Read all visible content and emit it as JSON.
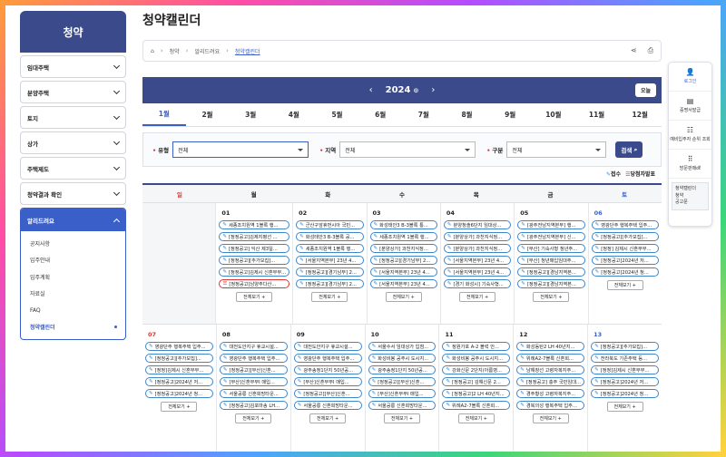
{
  "sidebar": {
    "title": "청약",
    "menus": [
      "임대주택",
      "분양주택",
      "토지",
      "상가",
      "주택제도",
      "청약결과 확인"
    ],
    "open_menu": "알리드려요",
    "sub_items": [
      "공지사항",
      "입주안내",
      "입주계획",
      "자료실",
      "FAQ",
      "청약캘린더"
    ]
  },
  "page_title": "청약캘린더",
  "breadcrumb": {
    "items": [
      "청약",
      "알리드려요",
      "청약캘린더"
    ]
  },
  "calendar": {
    "year": "2024",
    "today_label": "오늘",
    "months": [
      "1월",
      "2월",
      "3월",
      "4월",
      "5월",
      "6월",
      "7월",
      "8월",
      "9월",
      "10월",
      "11월",
      "12월"
    ],
    "weekdays": [
      "일",
      "월",
      "화",
      "수",
      "목",
      "금",
      "토"
    ],
    "more_label": "전체보기 +"
  },
  "filter": {
    "type_label": "유형",
    "type_value": "전체",
    "region_label": "지역",
    "region_value": "전체",
    "cat_label": "구분",
    "cat_value": "전체",
    "search_label": "검색"
  },
  "legend": {
    "receipt": "접수",
    "announce": "당첨자발표"
  },
  "week1": {
    "d1": "01",
    "d2": "02",
    "d3": "03",
    "d4": "04",
    "d5": "05",
    "d6": "06",
    "mon": [
      "세종조치원역 1블록 행...",
      "[정정공고]김제지평선 ...",
      "[정정공고] 익산 제3일...",
      "[정정공고][추가모집]...",
      "[정정공고]김제시 신혼부부...",
      "[정정공고]남양주다산..."
    ],
    "tue": [
      "군산구암휴먼시아 국민...",
      "화성태안3 B-3블록 공...",
      "세종조치원역 1블록 행...",
      "[서울지역본부] 23년 4...",
      "[정정공고][경기남부] 2...",
      "[정정공고][경기남부] 2..."
    ],
    "wed": [
      "화성태안3 B-3블록 통...",
      "세종조치원역 1블록 행...",
      "[분양상가] 과천지식정...",
      "[정정공고][경기남부] 2...",
      "[서울지역본부] 23년 4...",
      "[서울지역본부] 23년 4..."
    ],
    "thu": [
      "분양청솔6단지 임대상...",
      "[분양상가] 과천지식정...",
      "[분양상가] 과천지식정...",
      "[서울지역본부] 23년 4...",
      "[서울지역본부] 23년 4...",
      "[경기 화성시] 기숙사형..."
    ],
    "fri": [
      "[광주전남지역본부] 행...",
      "[광주전남지역본부] 신...",
      "[부산] 기숙사형 청년주...",
      "[부산] 청년매입임대주...",
      "[정정공고][경남지역본...",
      "[정정공고][경남지역본..."
    ],
    "sat": [
      "영광단주 행복주택 입주...",
      "[정정공고][추가모집]...",
      "[정정] 김제시 신혼부부...",
      "[정정공고]2024년 저...",
      "[정정공고]2024년 청..."
    ]
  },
  "week2": {
    "d0": "07",
    "d1": "08",
    "d2": "09",
    "d3": "10",
    "d4": "11",
    "d5": "12",
    "d6": "13",
    "sun": [
      "영광단주 행복주택 입주...",
      "[정정공고][추가모집]...",
      "[정정]김제시 신혼부부...",
      "[정정공고]2024년 저...",
      "[정정공고]2024년 청..."
    ],
    "mon": [
      "대전도안지구 휴교시설...",
      "영광단주 행복주택 입주...",
      "[정정공고][부산]신혼...",
      "[부산]신혼부부Ⅰ 매입...",
      "서울공릉 신혼희망타운...",
      "[정정공고]김포마송 LH..."
    ],
    "tue": [
      "대전도안지구 휴교시설...",
      "영광단주 행복주택 입주...",
      "광주송정1단지 50년공...",
      "[부산]신혼부부Ⅰ 매입...",
      "[정정공고][부산]신혼...",
      "서울공릉 신혼희망타운..."
    ],
    "wed": [
      "서울수서 임대상가 입점...",
      "화성비봉 공주시 도시지...",
      "광주송정1단지 50년공...",
      "[정정공고][부산]신혼...",
      "[부산]신혼부부Ⅰ 매입...",
      "서울공릉 신혼희망타운..."
    ],
    "thu": [
      "정원가포 A-2 블럭 안...",
      "화성비봉 공주시 도시지...",
      "강화신문 2단지(아름영...",
      "[정정공고] 김해신문 2...",
      "[정정공고]2 LH 40년지...",
      "위례A2-7블록 신혼희..."
    ],
    "fri": [
      "화성동탄2 LH 40년지...",
      "위례A2-7블록 신혼희...",
      "남해창선 고령자복지주...",
      "[정정공고] 충주 국민임대...",
      "경주황성 고령자복지주...",
      "경북의성 행복주택 입주..."
    ],
    "sat": [
      "[정정공고][추가모집]...",
      "전라북도 기존주택 등...",
      "[정정]김제시 신혼부부...",
      "[정정공고]2024년 저...",
      "[정정공고]2024년 청..."
    ]
  },
  "quick": {
    "login": "로그인",
    "cert": "증명서발급",
    "waitlist": "예비입주자 순위 조회",
    "visit": "방문판매㎗",
    "box": [
      "청약캘린더",
      "청약",
      "공고문"
    ]
  }
}
